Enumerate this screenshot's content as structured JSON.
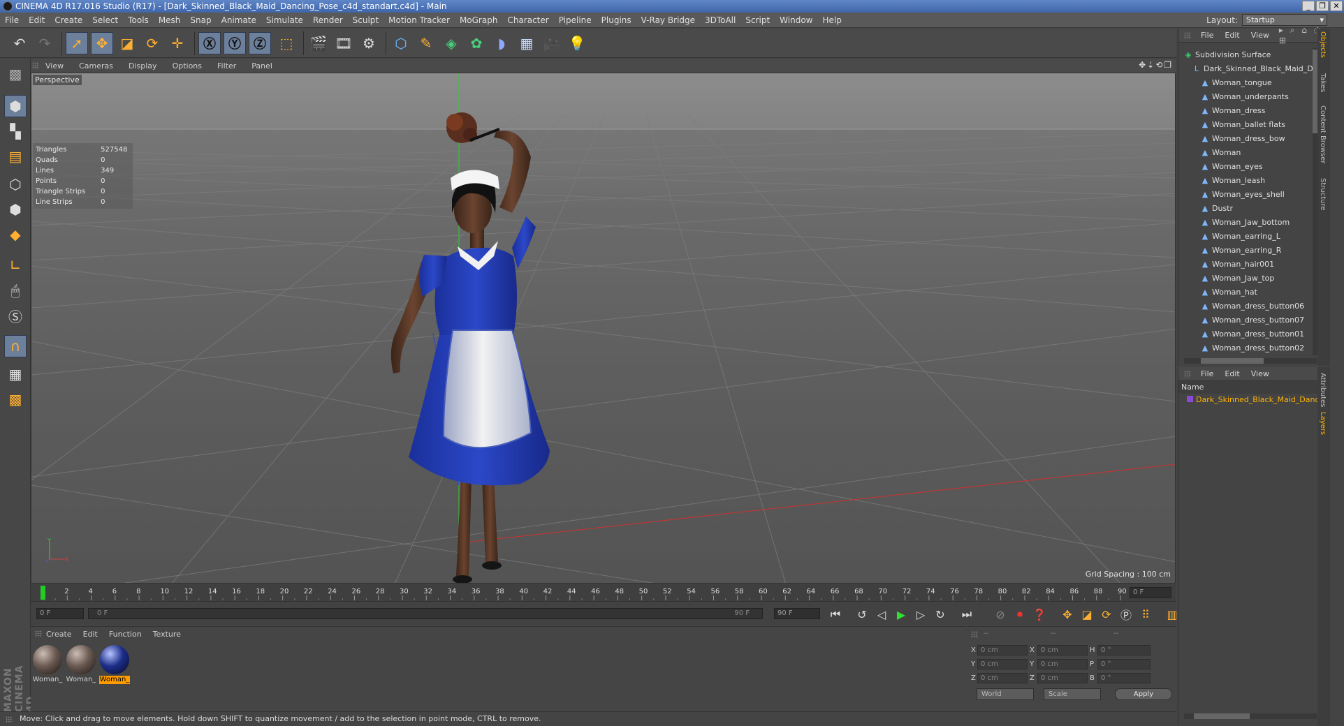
{
  "window": {
    "title": "CINEMA 4D R17.016 Studio (R17) - [Dark_Skinned_Black_Maid_Dancing_Pose_c4d_standart.c4d] - Main"
  },
  "menu": [
    "File",
    "Edit",
    "Create",
    "Select",
    "Tools",
    "Mesh",
    "Snap",
    "Animate",
    "Simulate",
    "Render",
    "Sculpt",
    "Motion Tracker",
    "MoGraph",
    "Character",
    "Pipeline",
    "Plugins",
    "V-Ray Bridge",
    "3DToAll",
    "Script",
    "Window",
    "Help"
  ],
  "layout": {
    "label": "Layout:",
    "value": "Startup"
  },
  "viewport": {
    "menu": [
      "View",
      "Cameras",
      "Display",
      "Options",
      "Filter",
      "Panel"
    ],
    "camera_label": "Perspective",
    "grid_spacing": "Grid Spacing : 100 cm",
    "stats": [
      {
        "label": "Triangles",
        "value": "527548"
      },
      {
        "label": "Quads",
        "value": "0"
      },
      {
        "label": "Lines",
        "value": "349"
      },
      {
        "label": "Points",
        "value": "0"
      },
      {
        "label": "Triangle Strips",
        "value": "0"
      },
      {
        "label": "Line Strips",
        "value": "0"
      }
    ]
  },
  "timeline": {
    "ticks": [
      "0",
      "2",
      "4",
      "6",
      "8",
      "10",
      "12",
      "14",
      "16",
      "18",
      "20",
      "22",
      "24",
      "26",
      "28",
      "30",
      "32",
      "34",
      "36",
      "38",
      "40",
      "42",
      "44",
      "46",
      "48",
      "50",
      "52",
      "54",
      "56",
      "58",
      "60",
      "62",
      "64",
      "66",
      "68",
      "70",
      "72",
      "74",
      "76",
      "78",
      "80",
      "82",
      "84",
      "86",
      "88",
      "90"
    ],
    "current_frame": "0 F",
    "start_field": "0 F",
    "range_start": "0 F",
    "range_end": "90 F",
    "end_field": "90 F"
  },
  "materials": {
    "menu": [
      "Create",
      "Edit",
      "Function",
      "Texture"
    ],
    "items": [
      {
        "label": "Woman_",
        "color": "#6b5a52"
      },
      {
        "label": "Woman_",
        "color": "#6b5a52"
      },
      {
        "label": "Woman_",
        "color": "#1c2e8a"
      }
    ]
  },
  "coordinates": {
    "headers": [
      "--",
      "--",
      "--"
    ],
    "rows": [
      {
        "a": "X",
        "av": "0 cm",
        "b": "X",
        "bv": "0 cm",
        "c": "H",
        "cv": "0 °"
      },
      {
        "a": "Y",
        "av": "0 cm",
        "b": "Y",
        "bv": "0 cm",
        "c": "P",
        "cv": "0 °"
      },
      {
        "a": "Z",
        "av": "0 cm",
        "b": "Z",
        "bv": "0 cm",
        "c": "B",
        "cv": "0 °"
      }
    ],
    "mode": "World",
    "scale": "Scale",
    "apply": "Apply"
  },
  "status": "Move: Click and drag to move elements. Hold down SHIFT to quantize movement / add to the selection in point mode, CTRL to remove.",
  "branding": "MAXON CINEMA 4D",
  "objects": {
    "menu": [
      "File",
      "Edit",
      "View"
    ],
    "items": [
      {
        "label": "Subdivision Surface",
        "indent": 0,
        "green": true
      },
      {
        "label": "Dark_Skinned_Black_Maid_Danc",
        "indent": 1,
        "green": false
      },
      {
        "label": "Woman_tongue",
        "indent": 2,
        "green": false
      },
      {
        "label": "Woman_underpants",
        "indent": 2,
        "green": false
      },
      {
        "label": "Woman_dress",
        "indent": 2,
        "green": false
      },
      {
        "label": "Woman_ballet flats",
        "indent": 2,
        "green": false
      },
      {
        "label": "Woman_dress_bow",
        "indent": 2,
        "green": false
      },
      {
        "label": "Woman",
        "indent": 2,
        "green": false
      },
      {
        "label": "Woman_eyes",
        "indent": 2,
        "green": false
      },
      {
        "label": "Woman_leash",
        "indent": 2,
        "green": false
      },
      {
        "label": "Woman_eyes_shell",
        "indent": 2,
        "green": false
      },
      {
        "label": "Dustr",
        "indent": 2,
        "green": false
      },
      {
        "label": "Woman_Jaw_bottom",
        "indent": 2,
        "green": false
      },
      {
        "label": "Woman_earring_L",
        "indent": 2,
        "green": false
      },
      {
        "label": "Woman_earring_R",
        "indent": 2,
        "green": false
      },
      {
        "label": "Woman_hair001",
        "indent": 2,
        "green": false
      },
      {
        "label": "Woman_Jaw_top",
        "indent": 2,
        "green": false
      },
      {
        "label": "Woman_hat",
        "indent": 2,
        "green": false
      },
      {
        "label": "Woman_dress_button06",
        "indent": 2,
        "green": false
      },
      {
        "label": "Woman_dress_button07",
        "indent": 2,
        "green": false
      },
      {
        "label": "Woman_dress_button01",
        "indent": 2,
        "green": false
      },
      {
        "label": "Woman_dress_button02",
        "indent": 2,
        "green": false
      }
    ],
    "side_tabs": [
      "Objects",
      "Takes",
      "Content Browser",
      "Structure"
    ]
  },
  "layers": {
    "menu": [
      "File",
      "Edit",
      "View"
    ],
    "column": "Name",
    "item": "Dark_Skinned_Black_Maid_Dancing_",
    "side_tabs": [
      "Attributes",
      "Layers"
    ]
  }
}
